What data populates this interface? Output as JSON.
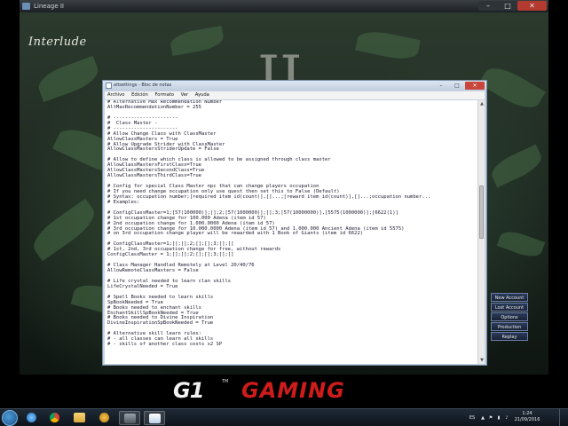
{
  "game_window": {
    "title": "Lineage II",
    "logo_text": "Interlude",
    "center_glyph": "II",
    "side_buttons": [
      "New Account",
      "Lost Account",
      "Options",
      "Production Team",
      "Replay"
    ]
  },
  "notepad": {
    "title": "altsettings - Bloc de notas",
    "menu": [
      "Archivo",
      "Edición",
      "Formato",
      "Ver",
      "Ayuda"
    ],
    "lines": [
      "# Alternative Max Recommendation Number",
      "AltMaxRecommendationNumber = 255",
      "",
      "# ----------------------",
      "#  Class Master -",
      "# ----------------------",
      "# Allow Change Class with ClassMaster",
      "AllowClassMasters = True",
      "# Allow Upgrade Strider with ClassMaster",
      "AllowClassMastersStriderUpdate = False",
      "",
      "# Allow to define which class is allowed to be assigned through class master",
      "AllowClassMastersFirstClass=True",
      "AllowClassMastersSecondClass=True",
      "AllowClassMastersThirdClass=True",
      "",
      "# Config for special Class Master npc that can change players occupation",
      "# If you need change occupation only use quest then set this to False (Default)",
      "# Syntax: occupation number;[required item id(count)],[]...;[reward item id(count)],[]...;occupation number...",
      "# Examples:",
      "",
      "# ConfigClassMaster=1;[57(100000)];[];2;[57(1000000)];[];3;[57(10000000)],[5575(1000000)];[6622(1)]",
      "# 1st occupation change for 100.000 Adena (item id 57)",
      "# 2nd occupation change for 1.000.0000 Adena (item id 57)",
      "# 3rd occupation change for 10.000.0000 Adena (item id 57) and 1.000.000 Ancient Adena (item id 5575)",
      "# on 3rd occupation change player will be rewarded with 1 Book of Giants (item id 6622)",
      "",
      "# ConfigClassMaster=1;[];[];2;[];[];3;[];[]",
      "# 1st, 2nd, 3rd occupation change for free, without rewards",
      "ConfigClassMaster = 1;[];[];2;[];[];3;[];[]",
      "",
      "# Class Manager Handled Remotely at Level 20/40/76",
      "AllowRemoteClassMasters = False",
      "",
      "# Life crystal needed to learn clan skills",
      "LifeCrystalNeeded = True",
      "",
      "# Spell Books needed to learn skills",
      "SpBookNeeded = True",
      "# Books needed to enchant skills",
      "EnchantSkillSpBookNeeded = True",
      "# Books needed to Divine Inspiration",
      "DivineInspirationSpBookNeeded = True",
      "",
      "# Alternative skill learn rules:",
      "# - all classes can learn all skills",
      "# - skills of another class costs x2 SP"
    ]
  },
  "banner": {
    "g1": "G1",
    "tm": "TM",
    "gaming": "GAMING"
  },
  "taskbar": {
    "language": "ES",
    "time": "1:24",
    "date": "21/09/2016"
  },
  "colors": {
    "banner_red": "#d01b1b",
    "close_red": "#b33a2e"
  }
}
